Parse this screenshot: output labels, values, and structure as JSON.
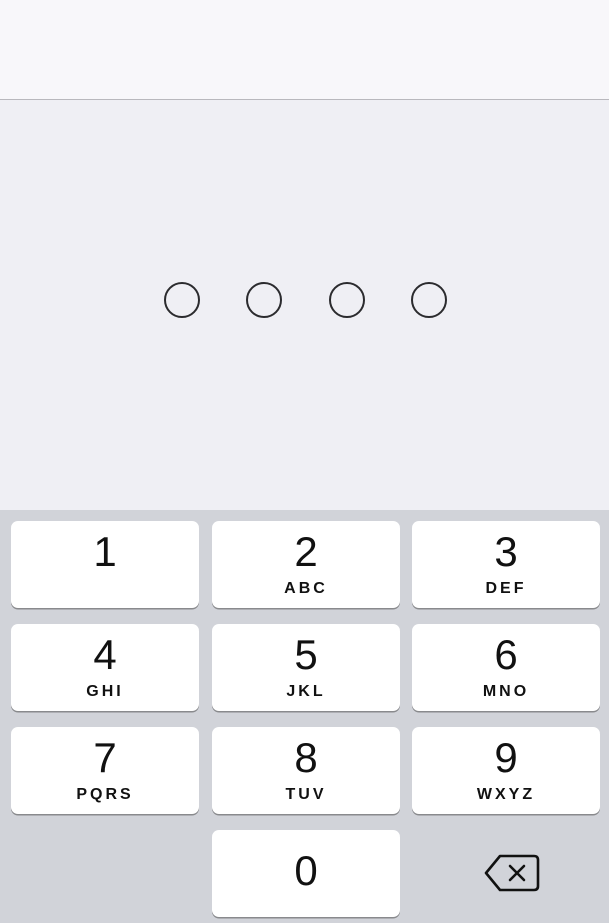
{
  "passcode": {
    "digits_entered": 0,
    "digits_total": 4
  },
  "keypad": {
    "keys": [
      {
        "digit": "1",
        "letters": ""
      },
      {
        "digit": "2",
        "letters": "ABC"
      },
      {
        "digit": "3",
        "letters": "DEF"
      },
      {
        "digit": "4",
        "letters": "GHI"
      },
      {
        "digit": "5",
        "letters": "JKL"
      },
      {
        "digit": "6",
        "letters": "MNO"
      },
      {
        "digit": "7",
        "letters": "PQRS"
      },
      {
        "digit": "8",
        "letters": "TUV"
      },
      {
        "digit": "9",
        "letters": "WXYZ"
      },
      {
        "digit": "0",
        "letters": ""
      }
    ],
    "delete_icon": "delete-backspace-icon"
  },
  "colors": {
    "background": "#efeff4",
    "nav_bar": "#f8f7fa",
    "keypad_background": "#d1d3d9",
    "key": "#ffffff",
    "dot_outline": "#2b2b2e"
  }
}
